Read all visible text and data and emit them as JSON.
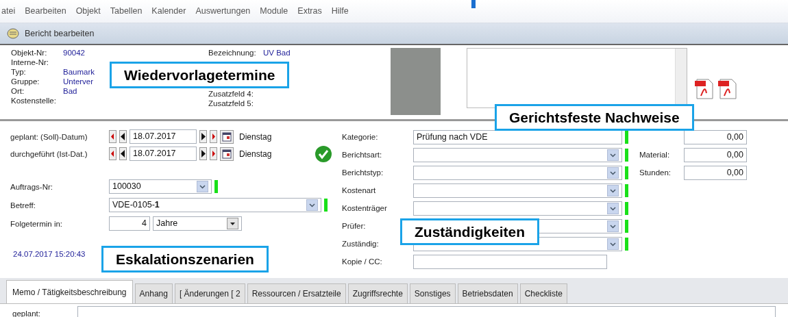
{
  "menu": [
    "atei",
    "Bearbeiten",
    "Objekt",
    "Tabellen",
    "Kalender",
    "Auswertungen",
    "Module",
    "Extras",
    "Hilfe"
  ],
  "toolbar": {
    "title": "Bericht bearbeiten"
  },
  "object_info": {
    "left": [
      {
        "label": "Objekt-Nr:",
        "value": "90042"
      },
      {
        "label": "Interne-Nr:"
      },
      {
        "label": "Typ:",
        "value": "Baumark"
      },
      {
        "label": "Gruppe:",
        "value": "Unterver"
      },
      {
        "label": "Ort:",
        "value": "Bad"
      },
      {
        "label": "Kostenstelle:"
      }
    ],
    "right": [
      {
        "label": "Bezeichnung:",
        "value": "UV Bad"
      },
      {
        "label": "Zusatzfeld 4:"
      },
      {
        "label": "Zusatzfeld 5:"
      }
    ]
  },
  "dates": [
    {
      "label": "geplant: (Soll)-Datum)",
      "date": "18.07.2017",
      "weekday": "Dienstag"
    },
    {
      "label": "durchgeführt (Ist-Dat.)",
      "date": "18.07.2017",
      "weekday": "Dienstag"
    }
  ],
  "done": true,
  "order": {
    "label": "Auftrags-Nr:",
    "value": "100030",
    "required": true
  },
  "subject": {
    "label": "Betreff:",
    "value": "VDE-0105-**1**",
    "required": true
  },
  "followup": {
    "label": "Folgetermin in:",
    "count": "4",
    "unit": "Jahre"
  },
  "timestamp": "24.07.2017 15:20:43",
  "report_fields": [
    {
      "kind": "text",
      "label": "Kategorie:",
      "value": "Prüfung nach VDE",
      "required": true
    },
    {
      "kind": "select",
      "label": "Berichtsart:",
      "required": true
    },
    {
      "kind": "select",
      "label": "Berichtstyp:",
      "required": true
    },
    {
      "kind": "select",
      "label": "Kostenart",
      "required": true
    },
    {
      "kind": "select",
      "label": "Kostenträger",
      "required": true
    },
    {
      "kind": "select",
      "label": "Prüfer:",
      "required": true
    },
    {
      "kind": "select",
      "label": "Zuständig:",
      "required": true
    },
    {
      "kind": "text",
      "label": "Kopie / CC:"
    }
  ],
  "costs": [
    {
      "value": "0,00"
    },
    {
      "label": "Material:",
      "value": "0,00"
    },
    {
      "label": "Stunden:",
      "value": "0,00"
    }
  ],
  "tabs": [
    {
      "label": "Memo / Tätigkeitsbeschreibung",
      "selected": true
    },
    {
      "label": "Anhang",
      "selected": false
    },
    {
      "label": "[ Änderungen [  2",
      "selected": false
    },
    {
      "label": "Ressourcen / Ersatzteile",
      "selected": false
    },
    {
      "label": "Zugriffsrechte",
      "selected": false
    },
    {
      "label": "Sonstiges",
      "selected": false
    },
    {
      "label": "Betriebsdaten",
      "selected": false
    },
    {
      "label": "Checkliste",
      "selected": false
    }
  ],
  "memo_tab": {
    "label": "geplant:"
  },
  "callouts": [
    "Wiedervorlagetermine",
    "Gerichtsfeste Nachweise",
    "Zuständigkeiten",
    "Eskalationszenarien"
  ]
}
